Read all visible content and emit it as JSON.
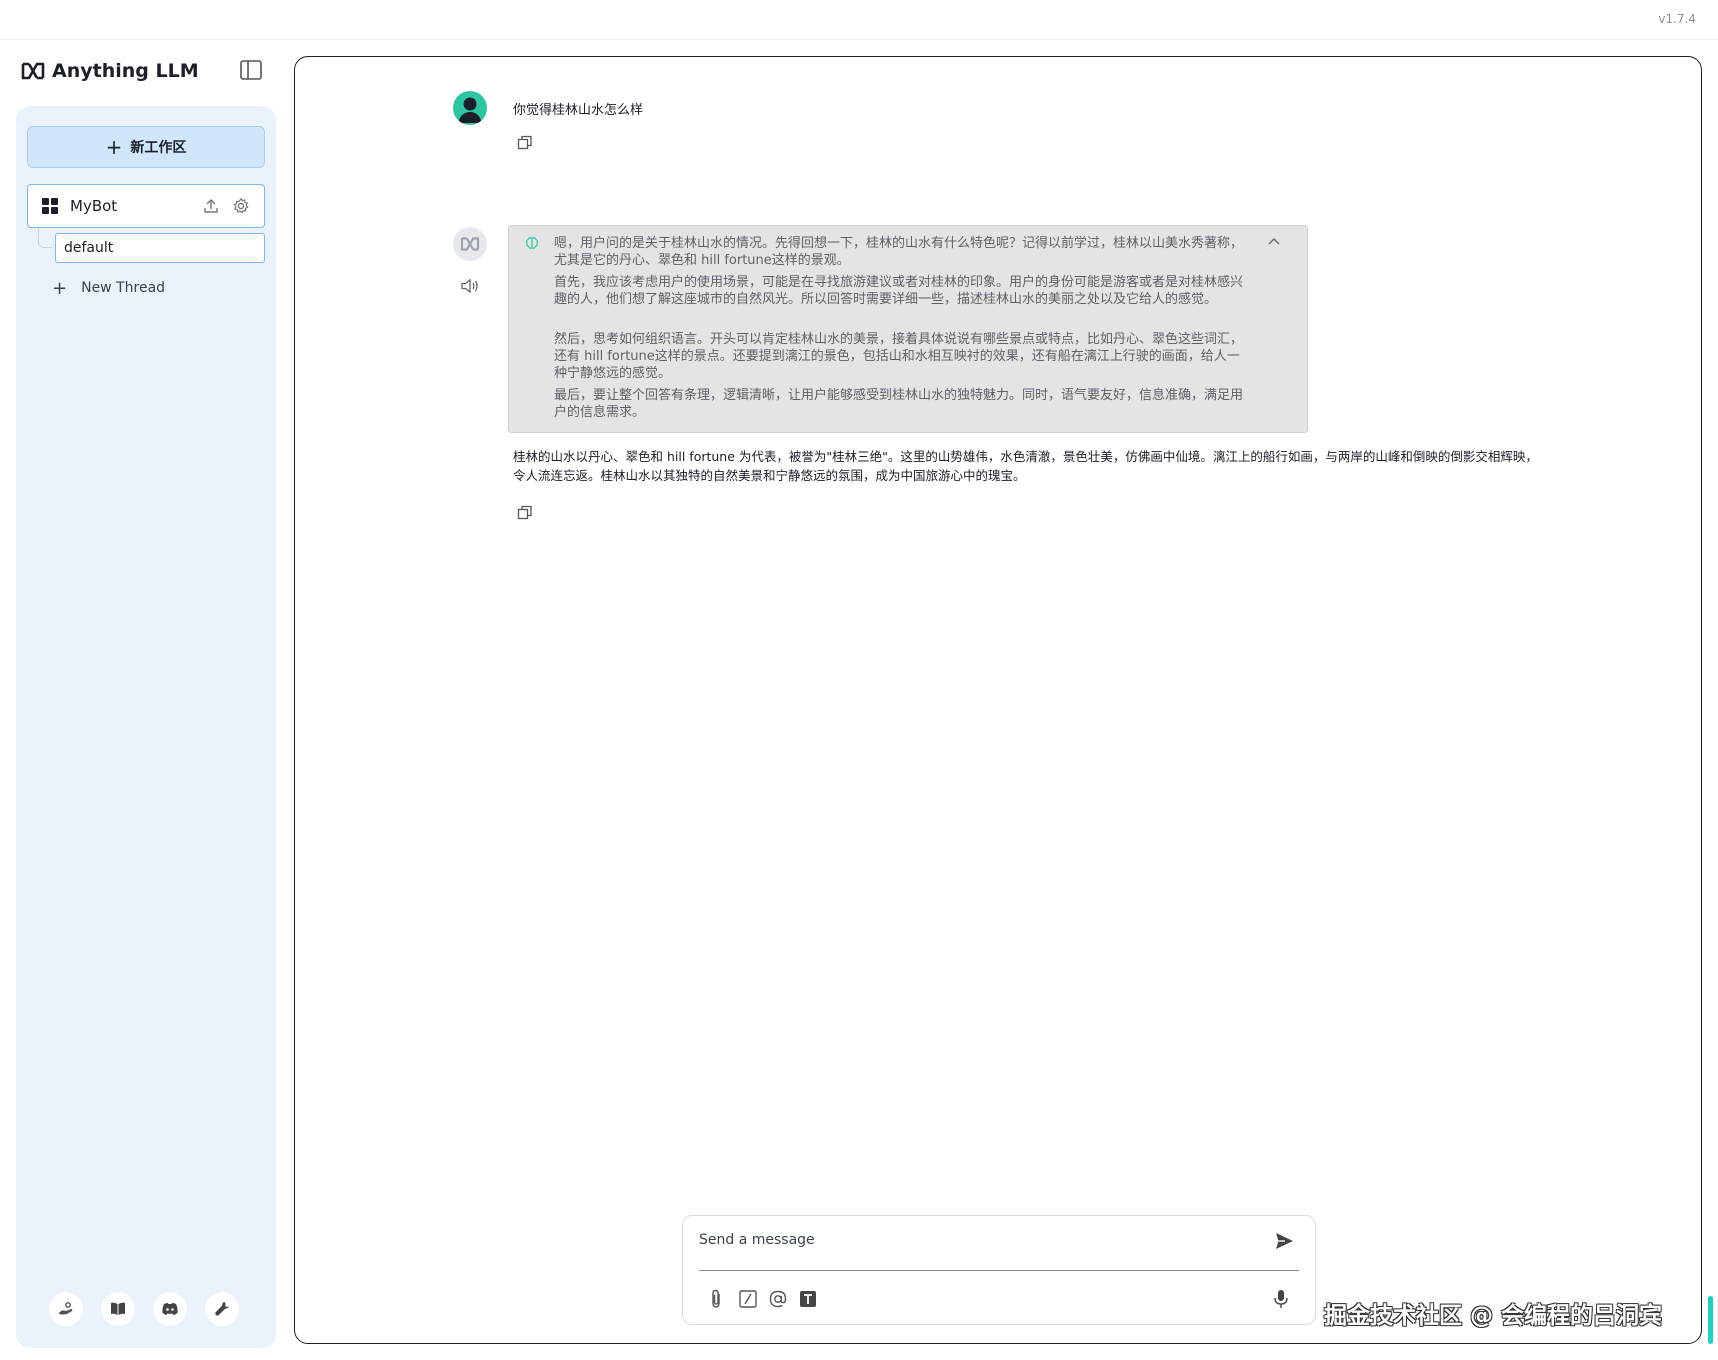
{
  "app": {
    "version": "v1.7.4",
    "brand": "Anything LLM"
  },
  "sidebar": {
    "new_workspace_label": "新工作区",
    "workspace": {
      "name": "MyBot",
      "threads": [
        {
          "label": "default"
        }
      ]
    },
    "new_thread_label": "New Thread",
    "footer_icons": [
      "community-hub-icon",
      "docs-book-icon",
      "discord-icon",
      "settings-wrench-icon"
    ]
  },
  "chat": {
    "user_message": "你觉得桂林山水怎么样",
    "thought": [
      "嗯，用户问的是关于桂林山水的情况。先得回想一下，桂林的山水有什么特色呢？记得以前学过，桂林以山美水秀著称，尤其是它的丹心、翠色和 hill fortune这样的景观。",
      "首先，我应该考虑用户的使用场景，可能是在寻找旅游建议或者对桂林的印象。用户的身份可能是游客或者是对桂林感兴趣的人，他们想了解这座城市的自然风光。所以回答时需要详细一些，描述桂林山水的美丽之处以及它给人的感觉。",
      "然后，思考如何组织语言。开头可以肯定桂林山水的美景，接着具体说说有哪些景点或特点，比如丹心、翠色这些词汇，还有 hill fortune这样的景点。还要提到漓江的景色，包括山和水相互映衬的效果，还有船在漓江上行驶的画面，给人一种宁静悠远的感觉。",
      "最后，要让整个回答有条理，逻辑清晰，让用户能够感受到桂林山水的独特魅力。同时，语气要友好，信息准确，满足用户的信息需求。"
    ],
    "answer": "桂林的山水以丹心、翠色和 hill fortune 为代表，被誉为\"桂林三绝\"。这里的山势雄伟，水色清澈，景色壮美，仿佛画中仙境。漓江上的船行如画，与两岸的山峰和倒映的倒影交相辉映，令人流连忘返。桂林山水以其独特的自然美景和宁静悠远的氛围，成为中国旅游心中的瑰宝。"
  },
  "composer": {
    "placeholder": "Send a message"
  },
  "watermark": "掘金技术社区 @ 会编程的吕洞宾",
  "colors": {
    "accent": "#2cc7a0",
    "sidebar_bg": "#eaf2fb",
    "button_bg": "#cfe6fb",
    "selected_border": "#7cb6ec"
  }
}
